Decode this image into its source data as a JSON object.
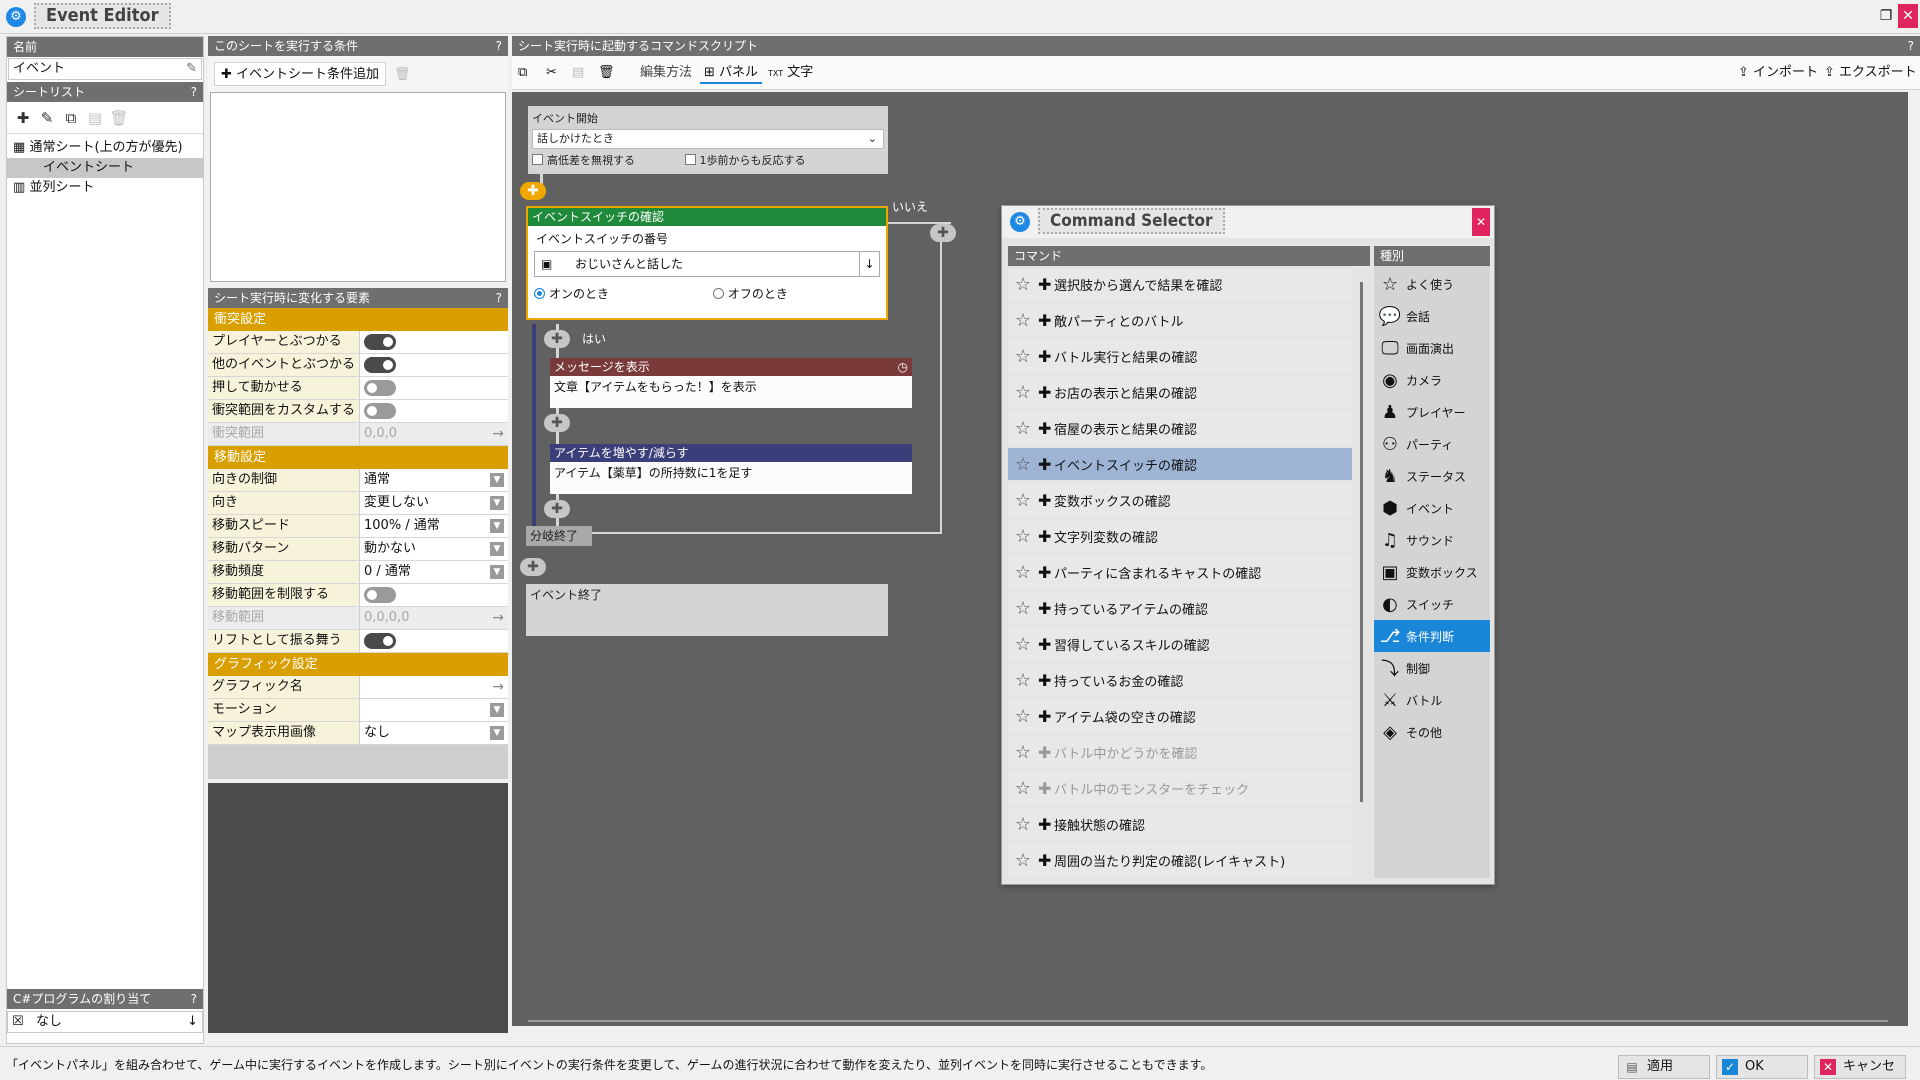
{
  "window": {
    "title": "Event Editor",
    "restore_glyph": "❐",
    "close_glyph": "✕"
  },
  "left": {
    "name_header": "名前",
    "name_value": "イベント",
    "sheet_list_header": "シートリスト",
    "help": "?",
    "tree": [
      {
        "label": "通常シート(上の方が優先)",
        "icon": "grid"
      },
      {
        "label": "イベントシート",
        "icon": "sub",
        "selected": true
      },
      {
        "label": "並列シート",
        "icon": "cal"
      }
    ],
    "csharp_header": "C#プログラムの割り当て",
    "csharp_value": "なし"
  },
  "conditions": {
    "header": "このシートを実行する条件",
    "add_label": "イベントシート条件追加"
  },
  "elements": {
    "header": "シート実行時に変化する要素",
    "sections": [
      {
        "title": "衝突設定",
        "rows": [
          {
            "key": "プレイヤーとぶつかる",
            "toggle": "on"
          },
          {
            "key": "他のイベントとぶつかる",
            "toggle": "on"
          },
          {
            "key": "押して動かせる",
            "toggle": "off"
          },
          {
            "key": "衝突範囲をカスタムする",
            "toggle": "off"
          },
          {
            "key": "衝突範囲",
            "value": "0,0,0",
            "dim": true,
            "arrow": true
          }
        ]
      },
      {
        "title": "移動設定",
        "rows": [
          {
            "key": "向きの制御",
            "value": "通常",
            "dd": true
          },
          {
            "key": "向き",
            "value": "変更しない",
            "dd": true
          },
          {
            "key": "移動スピード",
            "value": "100% / 通常",
            "dd": true
          },
          {
            "key": "移動パターン",
            "value": "動かない",
            "dd": true
          },
          {
            "key": "移動頻度",
            "value": "0 / 通常",
            "dd": true
          },
          {
            "key": "移動範囲を制限する",
            "toggle": "off"
          },
          {
            "key": "移動範囲",
            "value": "0,0,0,0",
            "dim": true,
            "arrow": true
          },
          {
            "key": "リフトとして振る舞う",
            "toggle": "on"
          }
        ]
      },
      {
        "title": "グラフィック設定",
        "rows": [
          {
            "key": "グラフィック名",
            "value": "",
            "arrow": true
          },
          {
            "key": "モーション",
            "value": "",
            "dd": true
          },
          {
            "key": "マップ表示用画像",
            "value": "なし",
            "dd": true
          }
        ]
      }
    ]
  },
  "script": {
    "header": "シート実行時に起動するコマンドスクリプト",
    "edit_method": "編集方法",
    "panel_label": "パネル",
    "text_label": "文字",
    "import_label": "インポート",
    "export_label": "エクスポート",
    "event_start": {
      "title": "イベント開始",
      "trigger": "話しかけたとき",
      "opt1": "高低差を無視する",
      "opt2": "1歩前からも反応する"
    },
    "switch_block": {
      "title": "イベントスイッチの確認",
      "number_label": "イベントスイッチの番号",
      "value": "おじいさんと話した",
      "on_label": "オンのとき",
      "off_label": "オフのとき",
      "no_label": "いいえ"
    },
    "yes_label": "はい",
    "message_block": {
      "title": "メッセージを表示",
      "body": "文章【アイテムをもらった！】を表示"
    },
    "item_block": {
      "title": "アイテムを増やす/減らす",
      "body": "アイテム【薬草】の所持数に1を足す"
    },
    "branch_end": "分岐終了",
    "event_end": "イベント終了"
  },
  "selector": {
    "title": "Command Selector",
    "commands_header": "コマンド",
    "categories_header": "種別",
    "commands": [
      {
        "label": "選択肢から選んで結果を確認"
      },
      {
        "label": "敵パーティとのバトル"
      },
      {
        "label": "バトル実行と結果の確認"
      },
      {
        "label": "お店の表示と結果の確認"
      },
      {
        "label": "宿屋の表示と結果の確認"
      },
      {
        "label": "イベントスイッチの確認",
        "selected": true
      },
      {
        "label": "変数ボックスの確認"
      },
      {
        "label": "文字列変数の確認"
      },
      {
        "label": "パーティに含まれるキャストの確認"
      },
      {
        "label": "持っているアイテムの確認"
      },
      {
        "label": "習得しているスキルの確認"
      },
      {
        "label": "持っているお金の確認"
      },
      {
        "label": "アイテム袋の空きの確認"
      },
      {
        "label": "バトル中かどうかを確認",
        "dim": true
      },
      {
        "label": "バトル中のモンスターをチェック",
        "dim": true
      },
      {
        "label": "接触状態の確認"
      },
      {
        "label": "周囲の当たり判定の確認(レイキャスト)"
      }
    ],
    "categories": [
      {
        "label": "よく使う",
        "icon": "star-icon",
        "glyph": "☆"
      },
      {
        "label": "会話",
        "icon": "speech-icon",
        "glyph": "💬"
      },
      {
        "label": "画面演出",
        "icon": "monitor-icon",
        "glyph": "🖵"
      },
      {
        "label": "カメラ",
        "icon": "camera-icon",
        "glyph": "◉"
      },
      {
        "label": "プレイヤー",
        "icon": "player-icon",
        "glyph": "♟"
      },
      {
        "label": "パーティ",
        "icon": "party-icon",
        "glyph": "⚇"
      },
      {
        "label": "ステータス",
        "icon": "status-icon",
        "glyph": "♞"
      },
      {
        "label": "イベント",
        "icon": "event-icon",
        "glyph": "⬢"
      },
      {
        "label": "サウンド",
        "icon": "sound-icon",
        "glyph": "♫"
      },
      {
        "label": "変数ボックス",
        "icon": "variable-icon",
        "glyph": "▣"
      },
      {
        "label": "スイッチ",
        "icon": "switch-icon",
        "glyph": "◐"
      },
      {
        "label": "条件判断",
        "icon": "branch-icon",
        "glyph": "⎇",
        "selected": true
      },
      {
        "label": "制御",
        "icon": "control-icon",
        "glyph": "⤵"
      },
      {
        "label": "バトル",
        "icon": "battle-icon",
        "glyph": "⚔"
      },
      {
        "label": "その他",
        "icon": "other-icon",
        "glyph": "◈"
      }
    ]
  },
  "status": {
    "message": "「イベントパネル」を組み合わせて、ゲーム中に実行するイベントを作成します。シート別にイベントの実行条件を変更して、ゲームの進行状況に合わせて動作を変えたり、並列イベントを同時に実行させることもできます。",
    "apply": "適用",
    "ok": "OK",
    "cancel": "キャンセル"
  },
  "colors": {
    "section": "#d99f00",
    "switch_block": "#1f8a3a",
    "message_block": "#7a3a3a",
    "item_block": "#3a3f7a",
    "selected_category": "#1a86d8",
    "selected_command": "#9db4d4",
    "canvas": "#616161"
  }
}
